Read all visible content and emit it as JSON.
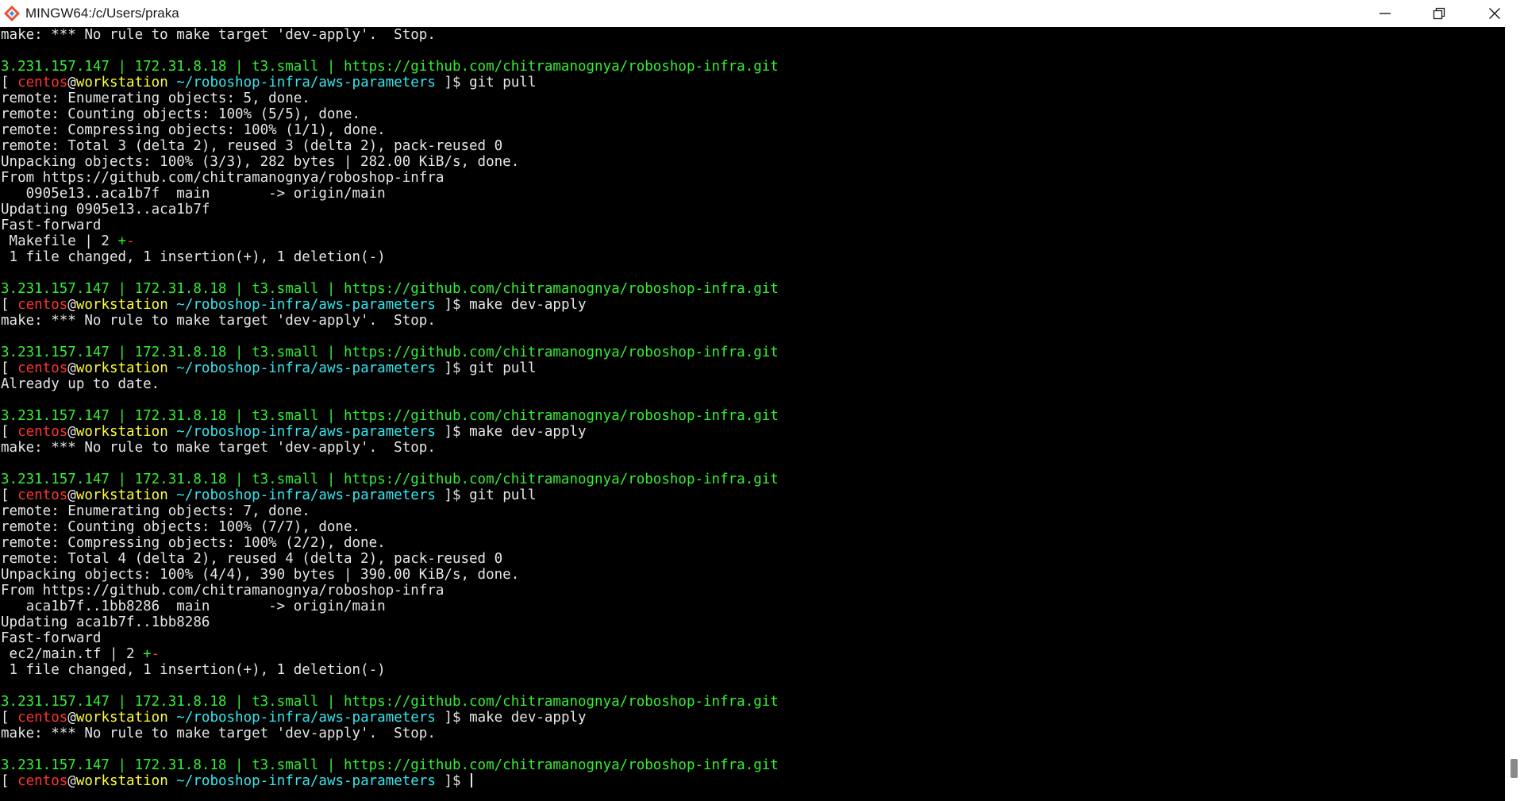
{
  "window": {
    "title": "MINGW64:/c/Users/praka",
    "controls": {
      "minimize": "minimize-icon",
      "maximize": "restore-icon",
      "close": "close-icon"
    }
  },
  "prompt": {
    "info": "3.231.157.147 | 172.31.8.18 | t3.small | https://github.com/chitramanognya/roboshop-infra.git",
    "user": "centos",
    "at": "@",
    "host": "workstation",
    "path": "~/roboshop-infra/aws-parameters",
    "open": "[ ",
    "close": " ]$ "
  },
  "terminal": {
    "lines": [
      {
        "t": "out",
        "text": "make: *** No rule to make target 'dev-apply'.  Stop."
      },
      {
        "t": "blank"
      },
      {
        "t": "info"
      },
      {
        "t": "prompt",
        "cmd": "git pull"
      },
      {
        "t": "out",
        "text": "remote: Enumerating objects: 5, done."
      },
      {
        "t": "out",
        "text": "remote: Counting objects: 100% (5/5), done."
      },
      {
        "t": "out",
        "text": "remote: Compressing objects: 100% (1/1), done."
      },
      {
        "t": "out",
        "text": "remote: Total 3 (delta 2), reused 3 (delta 2), pack-reused 0"
      },
      {
        "t": "out",
        "text": "Unpacking objects: 100% (3/3), 282 bytes | 282.00 KiB/s, done."
      },
      {
        "t": "out",
        "text": "From https://github.com/chitramanognya/roboshop-infra"
      },
      {
        "t": "out",
        "text": "   0905e13..aca1b7f  main       -> origin/main"
      },
      {
        "t": "out",
        "text": "Updating 0905e13..aca1b7f"
      },
      {
        "t": "out",
        "text": "Fast-forward"
      },
      {
        "t": "stat",
        "file": " Makefile | 2 ",
        "plus": "+",
        "minus": "-"
      },
      {
        "t": "out",
        "text": " 1 file changed, 1 insertion(+), 1 deletion(-)"
      },
      {
        "t": "blank"
      },
      {
        "t": "info"
      },
      {
        "t": "prompt",
        "cmd": "make dev-apply"
      },
      {
        "t": "out",
        "text": "make: *** No rule to make target 'dev-apply'.  Stop."
      },
      {
        "t": "blank"
      },
      {
        "t": "info"
      },
      {
        "t": "prompt",
        "cmd": "git pull"
      },
      {
        "t": "out",
        "text": "Already up to date."
      },
      {
        "t": "blank"
      },
      {
        "t": "info"
      },
      {
        "t": "prompt",
        "cmd": "make dev-apply"
      },
      {
        "t": "out",
        "text": "make: *** No rule to make target 'dev-apply'.  Stop."
      },
      {
        "t": "blank"
      },
      {
        "t": "info"
      },
      {
        "t": "prompt",
        "cmd": "git pull"
      },
      {
        "t": "out",
        "text": "remote: Enumerating objects: 7, done."
      },
      {
        "t": "out",
        "text": "remote: Counting objects: 100% (7/7), done."
      },
      {
        "t": "out",
        "text": "remote: Compressing objects: 100% (2/2), done."
      },
      {
        "t": "out",
        "text": "remote: Total 4 (delta 2), reused 4 (delta 2), pack-reused 0"
      },
      {
        "t": "out",
        "text": "Unpacking objects: 100% (4/4), 390 bytes | 390.00 KiB/s, done."
      },
      {
        "t": "out",
        "text": "From https://github.com/chitramanognya/roboshop-infra"
      },
      {
        "t": "out",
        "text": "   aca1b7f..1bb8286  main       -> origin/main"
      },
      {
        "t": "out",
        "text": "Updating aca1b7f..1bb8286"
      },
      {
        "t": "out",
        "text": "Fast-forward"
      },
      {
        "t": "stat",
        "file": " ec2/main.tf | 2 ",
        "plus": "+",
        "minus": "-"
      },
      {
        "t": "out",
        "text": " 1 file changed, 1 insertion(+), 1 deletion(-)"
      },
      {
        "t": "blank"
      },
      {
        "t": "info"
      },
      {
        "t": "prompt",
        "cmd": "make dev-apply"
      },
      {
        "t": "out",
        "text": "make: *** No rule to make target 'dev-apply'.  Stop."
      },
      {
        "t": "blank"
      },
      {
        "t": "info"
      },
      {
        "t": "prompt",
        "cmd": "",
        "cursor": true
      }
    ]
  },
  "colors": {
    "terminal_bg": "#000000",
    "text": "#e6e6e6",
    "info": "#33ee33",
    "user": "#ff3333",
    "host": "#ffff33",
    "path": "#33e8ee"
  }
}
